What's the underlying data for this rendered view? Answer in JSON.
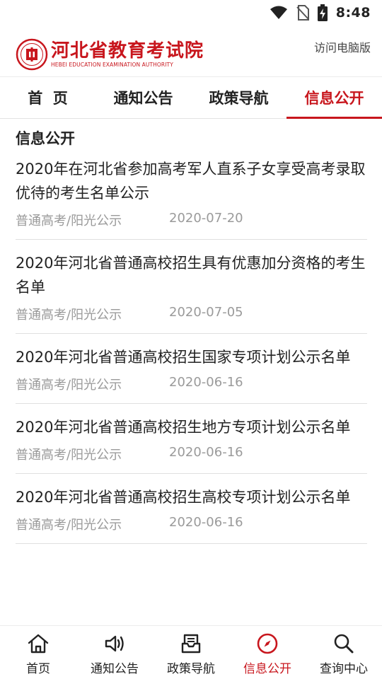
{
  "status": {
    "time": "8:48"
  },
  "header": {
    "logo_cn": "河北省教育考试院",
    "logo_en": "HEBEI EDUCATION EXAMINATION AUTHORITY",
    "desktop_link": "访问电脑版"
  },
  "top_nav": {
    "tabs": [
      {
        "label": "首  页"
      },
      {
        "label": "通知公告"
      },
      {
        "label": "政策导航"
      },
      {
        "label": "信息公开"
      }
    ],
    "active": "信息公开"
  },
  "section": {
    "title": "信息公开"
  },
  "news": [
    {
      "title": "2020年在河北省参加高考军人直系子女享受高考录取优待的考生名单公示",
      "category": "普通高考/阳光公示",
      "date": "2020-07-20"
    },
    {
      "title": "2020年河北省普通高校招生具有优惠加分资格的考生名单",
      "category": "普通高考/阳光公示",
      "date": "2020-07-05"
    },
    {
      "title": "2020年河北省普通高校招生国家专项计划公示名单",
      "category": "普通高考/阳光公示",
      "date": "2020-06-16"
    },
    {
      "title": "2020年河北省普通高校招生地方专项计划公示名单",
      "category": "普通高考/阳光公示",
      "date": "2020-06-16"
    },
    {
      "title": "2020年河北省普通高校招生高校专项计划公示名单",
      "category": "普通高考/阳光公示",
      "date": "2020-06-16"
    }
  ],
  "bottom_nav": {
    "items": [
      {
        "label": "首页",
        "icon": "home-icon"
      },
      {
        "label": "通知公告",
        "icon": "speaker-icon"
      },
      {
        "label": "政策导航",
        "icon": "inbox-icon"
      },
      {
        "label": "信息公开",
        "icon": "compass-icon"
      },
      {
        "label": "查询中心",
        "icon": "search-icon"
      }
    ],
    "active": "信息公开"
  },
  "colors": {
    "accent": "#c8161d",
    "text": "#222222",
    "meta": "#9a9a9a"
  }
}
